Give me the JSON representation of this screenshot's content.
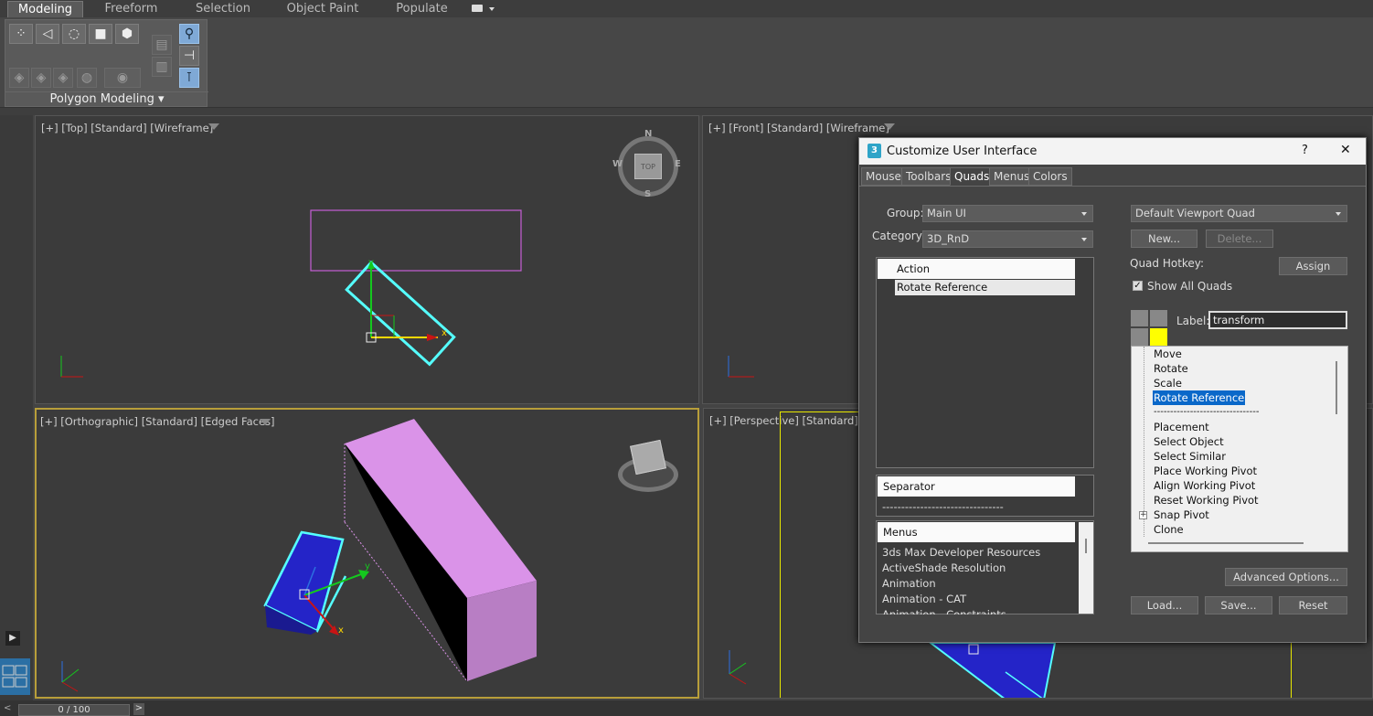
{
  "ribbon": {
    "tabs": [
      "Modeling",
      "Freeform",
      "Selection",
      "Object Paint",
      "Populate"
    ],
    "active_tab": "Modeling",
    "panel_title": "Polygon Modeling"
  },
  "viewports": {
    "top": "[+] [Top] [Standard] [Wireframe]",
    "front": "[+] [Front] [Standard] [Wireframe]",
    "ortho": "[+] [Orthographic] [Standard] [Edged Faces]",
    "persp": "[+] [Perspective] [Standard] [Ed",
    "compass": {
      "n": "N",
      "s": "S",
      "w": "W",
      "e": "E",
      "cube": "TOP"
    },
    "axes": {
      "x": "x",
      "y": "y",
      "z": "z"
    }
  },
  "timeline": {
    "frame": "0 / 100"
  },
  "dialog": {
    "title": "Customize User Interface",
    "help": "?",
    "close": "✕",
    "tabs": [
      "Mouse",
      "Toolbars",
      "Quads",
      "Menus",
      "Colors"
    ],
    "active_tab": "Quads",
    "group_label": "Group:",
    "group_value": "Main UI",
    "category_label": "Category:",
    "category_value": "3D_RnD",
    "action_header": "Action",
    "actions": [
      "Rotate Reference"
    ],
    "separator_header": "Separator",
    "separator_value": "--------------------------------",
    "menus_header": "Menus",
    "menus": [
      "3ds Max Developer Resources",
      "ActiveShade Resolution",
      "Animation",
      "Animation - CAT",
      "Animation - Constraints"
    ],
    "quad_select": "Default Viewport Quad",
    "new_button": "New...",
    "delete_button": "Delete...",
    "quad_hotkey_label": "Quad Hotkey:",
    "assign_button": "Assign",
    "show_all_quads": "Show All Quads",
    "show_all_quads_checked": true,
    "label_label": "Label:",
    "label_value": "transform",
    "quad_items": [
      "Move",
      "Rotate",
      "Scale",
      "Rotate Reference",
      "--------------------------------",
      "Placement",
      "Select Object",
      "Select Similar",
      "Place Working Pivot",
      "Align Working Pivot",
      "Reset Working Pivot",
      "Snap Pivot",
      "Clone"
    ],
    "quad_selected": "Rotate Reference",
    "expand_glyph": "+",
    "advanced_button": "Advanced Options...",
    "load_button": "Load...",
    "save_button": "Save...",
    "reset_button": "Reset"
  },
  "colors": {
    "accent": "#0a68c9",
    "active_quad": "#ffff00",
    "selection": "#55ffff",
    "object_pink": "#da93e8",
    "object_blue": "#2424c8"
  }
}
